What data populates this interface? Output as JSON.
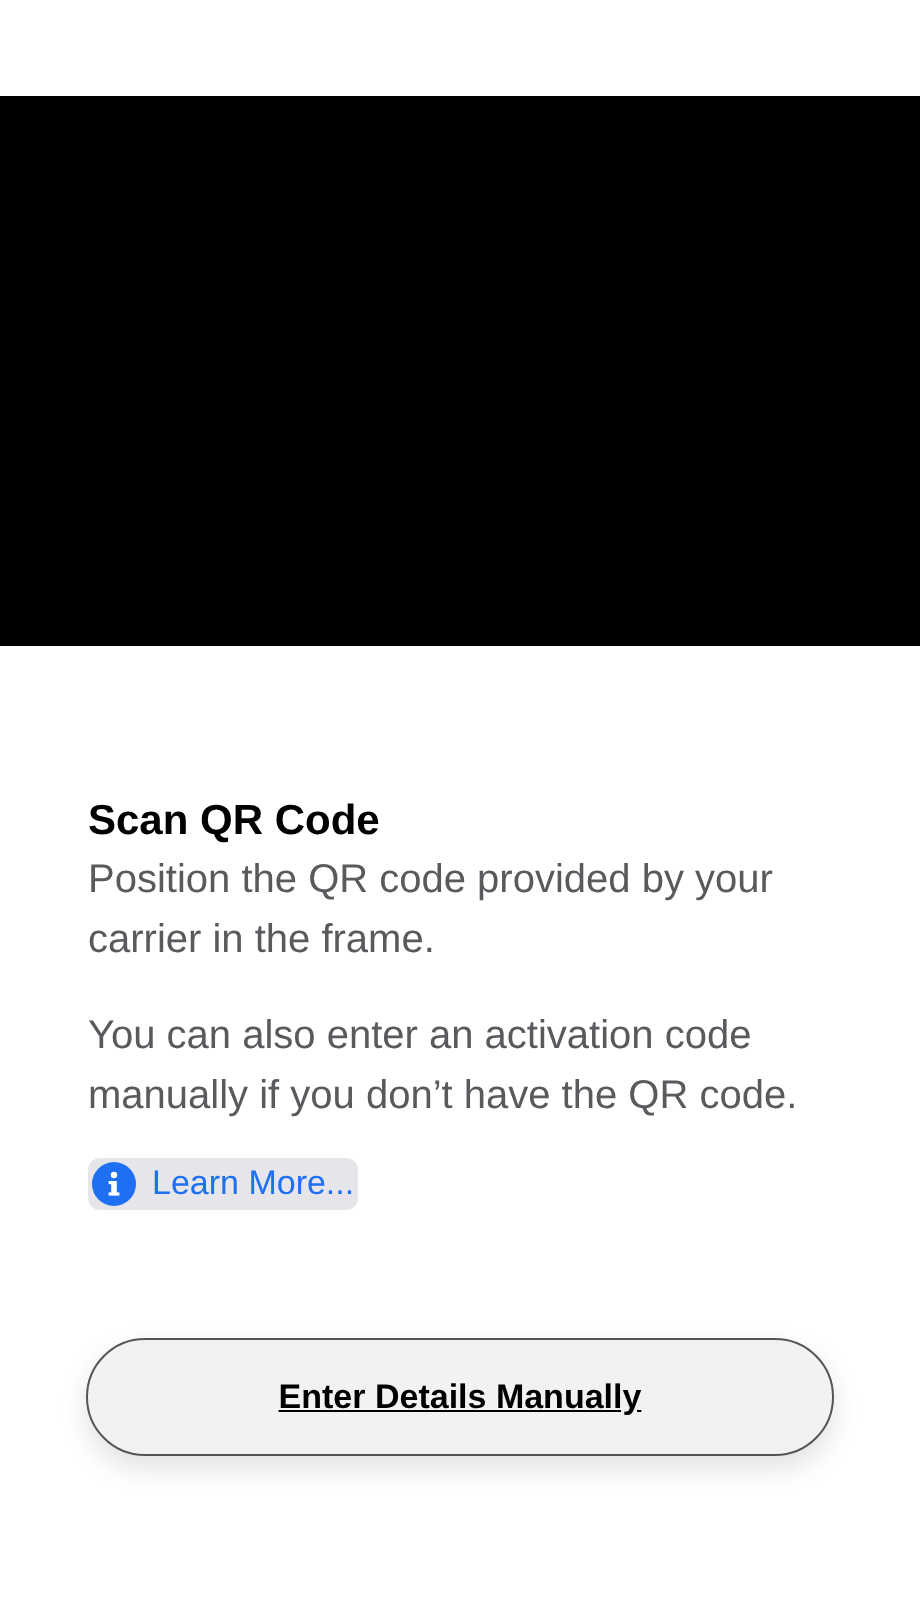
{
  "title": "Scan QR Code",
  "paragraphs": [
    "Position the QR code provided by your carrier in the frame.",
    "You can also enter an activation code manually if you don’t have the QR code."
  ],
  "learn_more": {
    "label": "Learn More..."
  },
  "button": {
    "label": "Enter Details Manually"
  }
}
